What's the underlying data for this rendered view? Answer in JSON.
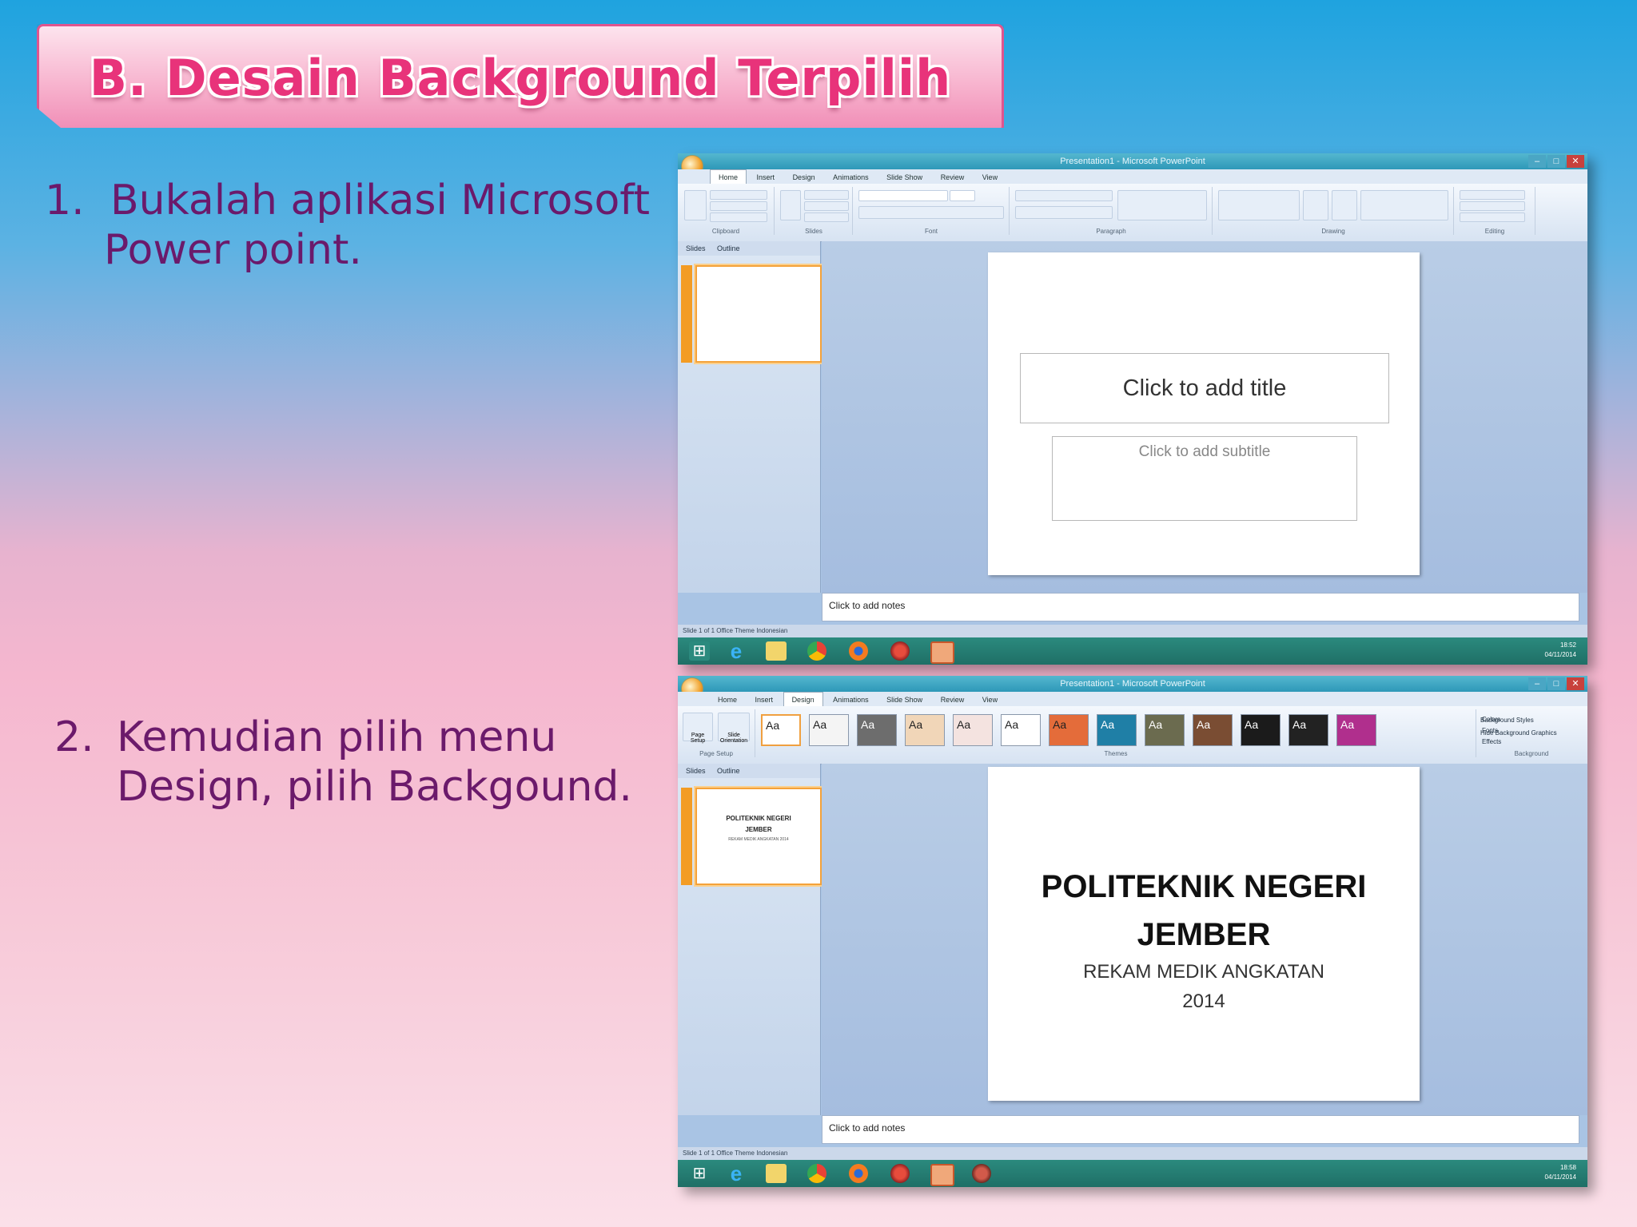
{
  "slide": {
    "title": "B. Desain Background Terpilih",
    "steps": [
      {
        "num": "1.",
        "line1": "Bukalah aplikasi Microsoft",
        "line2": "Power point."
      },
      {
        "num": "2.",
        "line1": "Kemudian pilih menu",
        "line2": "Design, pilih Backgound."
      }
    ]
  },
  "screenshot1": {
    "window_title": "Presentation1 - Microsoft PowerPoint",
    "tabs": [
      "Home",
      "Insert",
      "Design",
      "Animations",
      "Slide Show",
      "Review",
      "View"
    ],
    "active_tab": "Home",
    "ribbon_groups": [
      "Clipboard",
      "Slides",
      "Font",
      "Paragraph",
      "Drawing",
      "Editing"
    ],
    "pane_tabs": [
      "Slides",
      "Outline"
    ],
    "title_placeholder": "Click to add title",
    "subtitle_placeholder": "Click to add subtitle",
    "notes_placeholder": "Click to add notes",
    "status": "Slide 1 of 1    Office Theme    Indonesian",
    "clock_time": "18:52",
    "clock_date": "04/11/2014"
  },
  "screenshot2": {
    "window_title": "Presentation1 - Microsoft PowerPoint",
    "tabs": [
      "Home",
      "Insert",
      "Design",
      "Animations",
      "Slide Show",
      "Review",
      "View"
    ],
    "active_tab": "Design",
    "ribbon_groups": [
      "Page Setup",
      "Themes",
      "Background"
    ],
    "theme_label": "Aa",
    "page_setup_buttons": [
      "Page Setup",
      "Slide Orientation"
    ],
    "theme_options": [
      "Colors",
      "Fonts",
      "Effects"
    ],
    "background_options": [
      "Background Styles",
      "Hide Background Graphics"
    ],
    "pane_tabs": [
      "Slides",
      "Outline"
    ],
    "slide_title_line1": "POLITEKNIK NEGERI",
    "slide_title_line2": "JEMBER",
    "slide_subtitle_line1": "REKAM MEDIK ANGKATAN",
    "slide_subtitle_line2": "2014",
    "thumb_title_line1": "POLITEKNIK NEGERI",
    "thumb_title_line2": "JEMBER",
    "thumb_subtitle": "REKAM MEDIK ANGKATAN 2014",
    "notes_placeholder": "Click to add notes",
    "status": "Slide 1 of 1    Office Theme    Indonesian",
    "clock_time": "18:58",
    "clock_date": "04/11/2014"
  },
  "theme_colors": [
    "#ffffff",
    "#f4f4f4",
    "#6d6d6d",
    "#f1d6b8",
    "#f4e3e0",
    "#ffffff",
    "#e46c3a",
    "#1f7fa6",
    "#6b6b4f",
    "#7a4d33",
    "#1b1b1b",
    "#222222",
    "#b02f8d"
  ]
}
